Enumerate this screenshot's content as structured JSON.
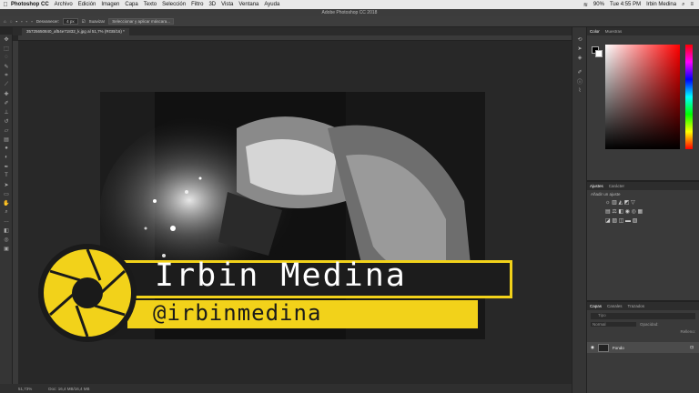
{
  "menubar": {
    "app_name": "Photoshop CC",
    "items": [
      "Archivo",
      "Edición",
      "Imagen",
      "Capa",
      "Texto",
      "Selección",
      "Filtro",
      "3D",
      "Vista",
      "Ventana",
      "Ayuda"
    ],
    "battery": "90%",
    "time": "Tue 4:55 PM",
    "user": "Irbin Medina"
  },
  "window_title": "Adobe Photoshop CC 2018",
  "options": {
    "feather_label": "Desvanecer:",
    "feather_value": "4 px",
    "smooth_label": "Suavizar",
    "select_mask_button": "Seleccionar y aplicar máscara..."
  },
  "document_tab": "35725650840_af54e71832_k.jpg al 51,7% (RGB/16) *",
  "statusbar": {
    "zoom": "51,73%",
    "doc_info": "Doc: 16,4 MB/16,4 MB"
  },
  "color_panel": {
    "tabs": [
      "Color",
      "Muestras"
    ],
    "hue_accent": "#ff0000"
  },
  "adjust_panel": {
    "tabs": [
      "Ajustes",
      "Carácter"
    ],
    "add_label": "Añadir un ajuste"
  },
  "layers_panel": {
    "tabs": [
      "Capas",
      "Canales",
      "Trazados"
    ],
    "filter_placeholder": "Tipo",
    "blend_mode": "Normal",
    "opacity_label": "Opacidad:",
    "fill_label": "Relleno:",
    "layer_name": "Fondo"
  },
  "overlay": {
    "name": "Irbin Medina",
    "handle": "@irbinmedina",
    "accent": "#f2d21a"
  }
}
